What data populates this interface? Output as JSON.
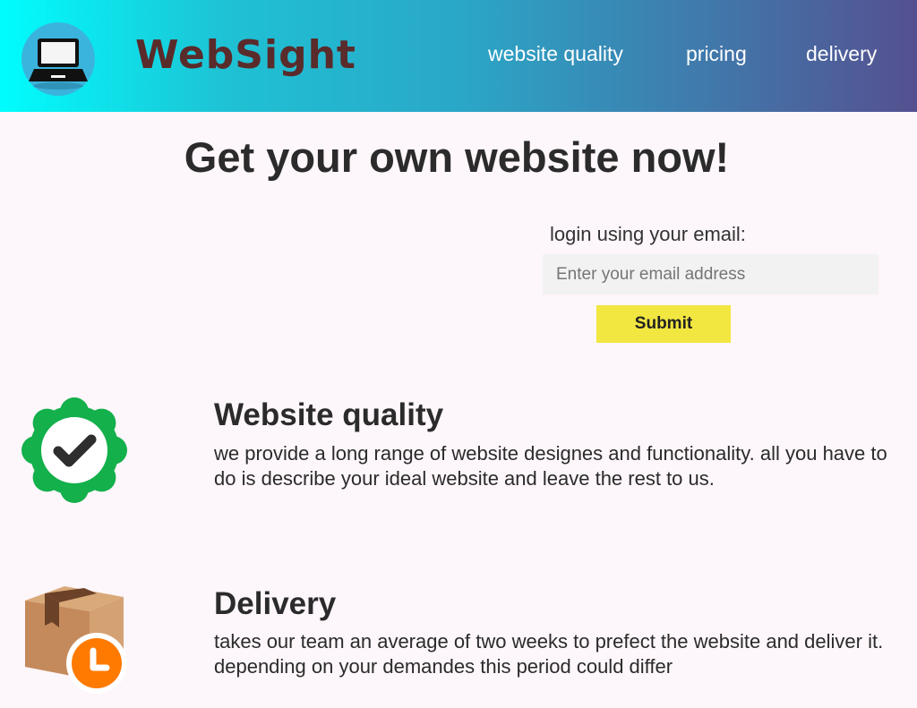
{
  "header": {
    "brand": "WebSight",
    "logo_icon": "laptop-icon",
    "nav": [
      {
        "label": "website quality"
      },
      {
        "label": "pricing"
      },
      {
        "label": "delivery"
      }
    ]
  },
  "hero": {
    "headline": "Get your own website now!"
  },
  "login": {
    "label": "login using your email:",
    "email_placeholder": "Enter your email address",
    "email_value": "",
    "submit_label": "Submit"
  },
  "features": [
    {
      "icon": "verified-badge-icon",
      "title": "Website quality",
      "text": "we provide a long range of website designes and functionality. all you have to do is describe your ideal website and leave the rest to us."
    },
    {
      "icon": "package-clock-icon",
      "title": "Delivery",
      "text": "takes our team an average of two weeks to prefect the website and deliver it. depending on your demandes this period could differ"
    }
  ],
  "colors": {
    "header_gradient_start": "#00fdfd",
    "header_gradient_end": "#555090",
    "brand_text": "#5a2b2b",
    "submit_button": "#f2e641",
    "badge_green": "#13b04b",
    "clock_orange": "#ff7a00",
    "page_background": "#fdf6fa"
  }
}
